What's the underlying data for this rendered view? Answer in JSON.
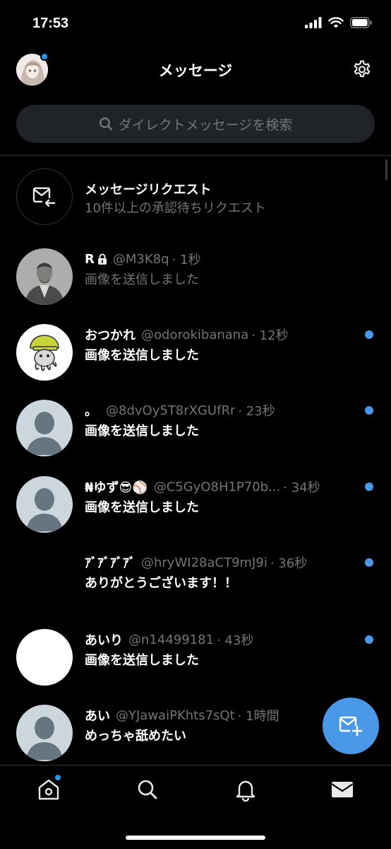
{
  "status_bar": {
    "time": "17:53"
  },
  "header": {
    "title": "メッセージ"
  },
  "search": {
    "placeholder": "ダイレクトメッセージを検索"
  },
  "requests": {
    "title": "メッセージリクエスト",
    "subtitle": "10件以上の承認待ちリクエスト"
  },
  "conversations": [
    {
      "name": "R",
      "handle": "@M3K8q",
      "time": "· 1秒",
      "message": "画像を送信しました",
      "unread": false,
      "locked": true
    },
    {
      "name": "おつかれ",
      "handle": "@odorokibanana",
      "time": "· 12秒",
      "message": "画像を送信しました",
      "unread": true
    },
    {
      "name": "。",
      "handle": "@8dvOy5T8rXGUfRr",
      "time": "· 23秒",
      "message": "画像を送信しました",
      "unread": true
    },
    {
      "name": "₦ゆず😎⚾",
      "handle": "@C5GyO8H1P70b...",
      "time": "· 34秒",
      "message": "画像を送信しました",
      "unread": true
    },
    {
      "name": "ｱﾞｱﾞｱﾞｱﾞ",
      "handle": "@hryWI28aCT9mJ9i",
      "time": "· 36秒",
      "message": "ありがとうございます！！",
      "unread": true
    },
    {
      "name": "あいり",
      "handle": "@n14499181",
      "time": "· 43秒",
      "message": "画像を送信しました",
      "unread": true
    },
    {
      "name": "あい",
      "handle": "@YJawaiPKhts7sQt",
      "time": "· 1時間",
      "message": "めっちゃ舐めたい",
      "unread": false
    }
  ],
  "icons": {
    "settings": "gear-icon",
    "search": "search-icon",
    "requests": "mail-request-icon",
    "fab": "new-message-icon",
    "nav": [
      "home-icon",
      "search-icon",
      "bell-icon",
      "mail-icon"
    ]
  },
  "colors": {
    "accent": "#1d9bf0",
    "unread_dot": "#4a99e9",
    "secondary_text": "#71767b",
    "background": "#000000"
  }
}
